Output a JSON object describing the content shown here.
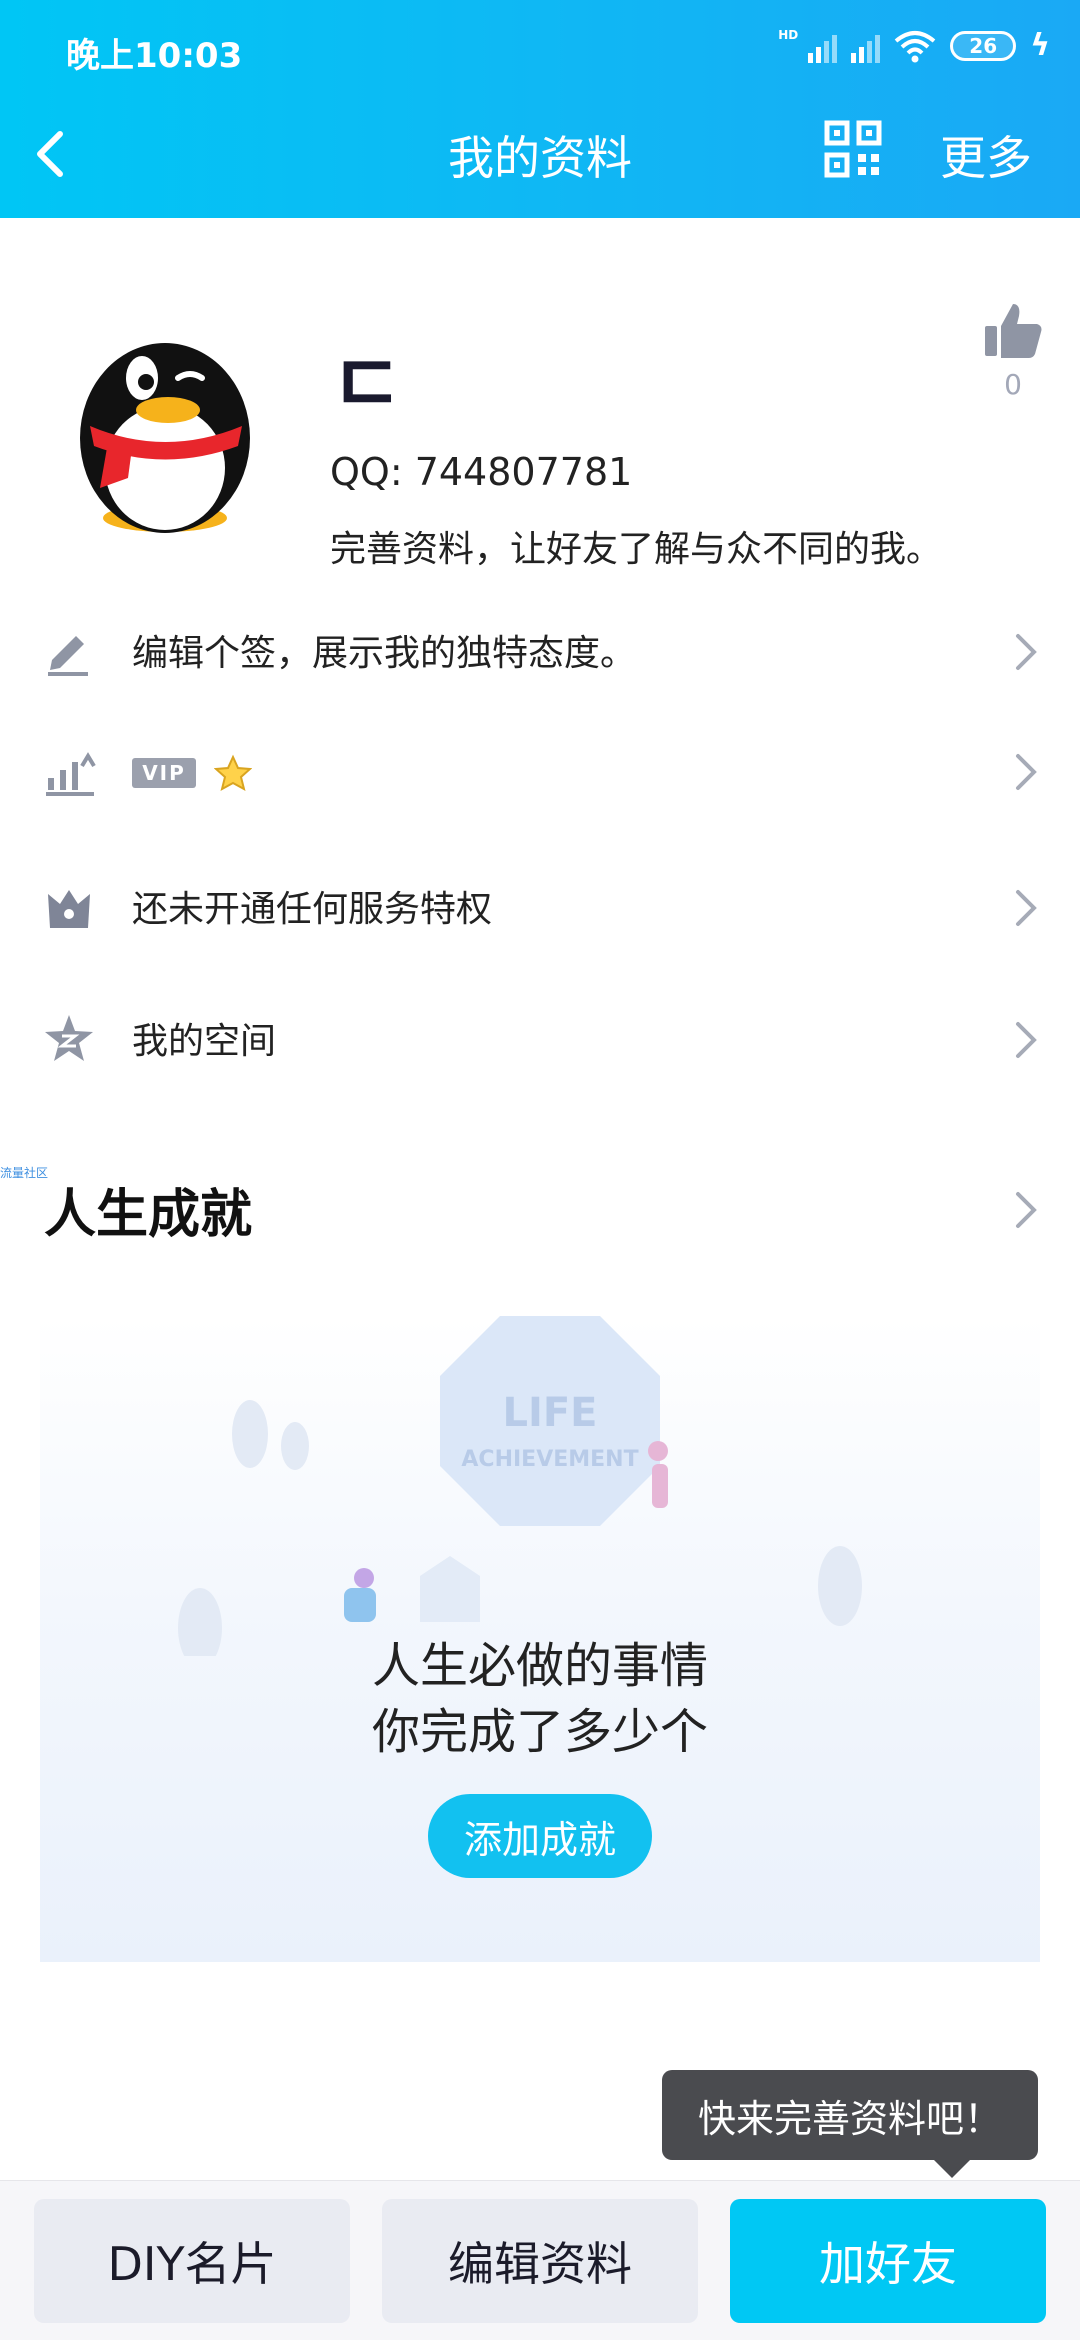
{
  "status_bar": {
    "time": "晚上10:03",
    "hd_label": "HD",
    "battery": "26"
  },
  "nav": {
    "title": "我的资料",
    "more": "更多"
  },
  "profile": {
    "nickname": "ㄷ",
    "qq_label": "QQ: 744807781",
    "intro": "完善资料，让好友了解与众不同的我。",
    "like_count": "0"
  },
  "rows": [
    {
      "label": "编辑个签，展示我的独特态度。",
      "icon": "pencil-icon"
    },
    {
      "badge": "VIP",
      "icon": "level-up-icon"
    },
    {
      "label": "还未开通任何服务特权",
      "icon": "crown-bag-icon"
    },
    {
      "label": "我的空间",
      "icon": "qzone-star-icon"
    }
  ],
  "tiny_label": "流量社区",
  "achievements": {
    "title": "人生成就",
    "line1": "人生必做的事情",
    "line2": "你完成了多少个",
    "add_button": "添加成就",
    "art_text1": "LIFE",
    "art_text2": "ACHIEVEMENT"
  },
  "tooltip": "快来完善资料吧！",
  "bottom_buttons": {
    "diy": "DIY名片",
    "edit": "编辑资料",
    "add_friend": "加好友"
  },
  "colors": {
    "header_start": "#00c6f5",
    "header_end": "#1aa9f5",
    "primary": "#00c8f4",
    "icon_gray": "#9ba0ad"
  }
}
